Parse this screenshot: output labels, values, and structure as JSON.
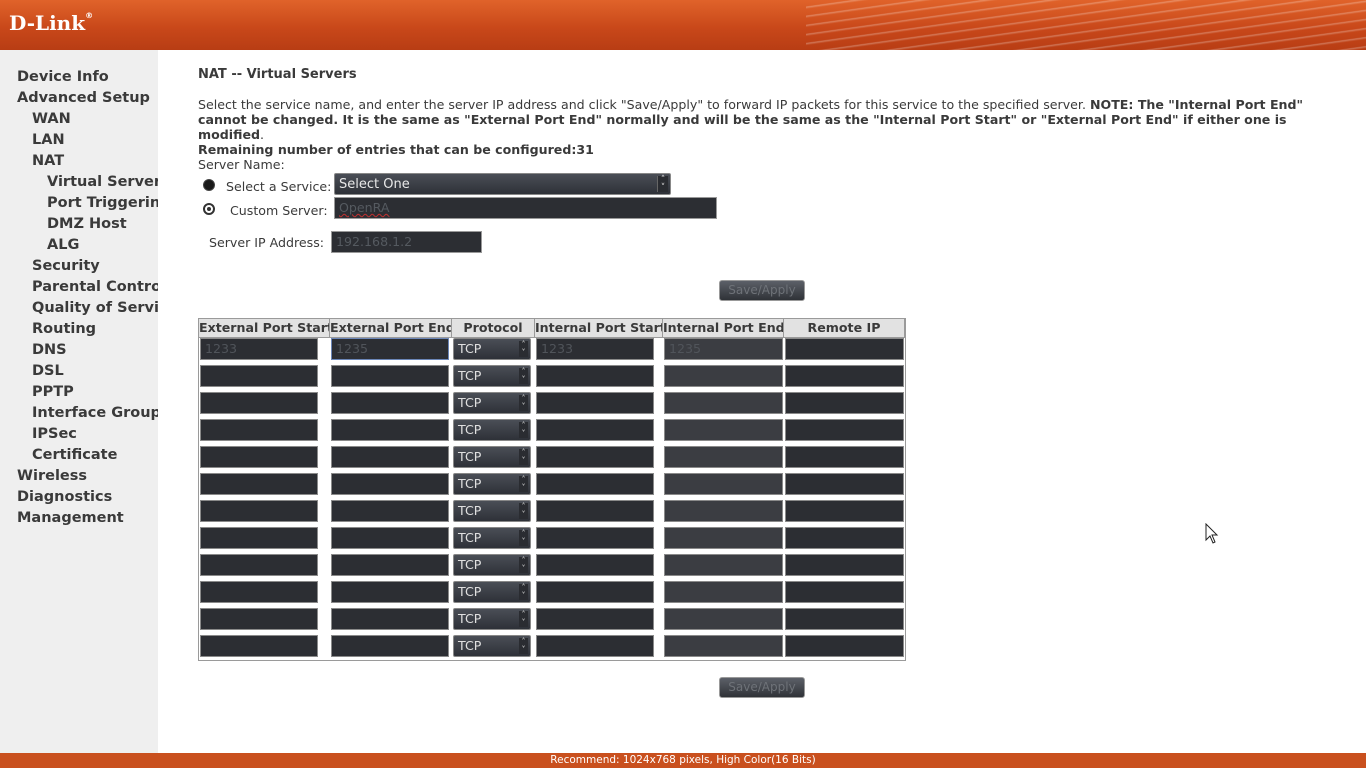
{
  "header": {
    "logo": "D-Link",
    "logo_mark": "®"
  },
  "sidebar": {
    "items": [
      {
        "label": "Device Info",
        "level": 0
      },
      {
        "label": "Advanced Setup",
        "level": 0
      },
      {
        "label": "WAN",
        "level": 1
      },
      {
        "label": "LAN",
        "level": 1
      },
      {
        "label": "NAT",
        "level": 1
      },
      {
        "label": "Virtual Servers",
        "level": 2
      },
      {
        "label": "Port Triggering",
        "level": 2
      },
      {
        "label": "DMZ Host",
        "level": 2
      },
      {
        "label": "ALG",
        "level": 2
      },
      {
        "label": "Security",
        "level": 1
      },
      {
        "label": "Parental Control",
        "level": 1
      },
      {
        "label": "Quality of Service",
        "level": 1
      },
      {
        "label": "Routing",
        "level": 1
      },
      {
        "label": "DNS",
        "level": 1
      },
      {
        "label": "DSL",
        "level": 1
      },
      {
        "label": "PPTP",
        "level": 1
      },
      {
        "label": "Interface Grouping",
        "level": 1
      },
      {
        "label": "IPSec",
        "level": 1
      },
      {
        "label": "Certificate",
        "level": 1
      },
      {
        "label": "Wireless",
        "level": 0
      },
      {
        "label": "Diagnostics",
        "level": 0
      },
      {
        "label": "Management",
        "level": 0
      }
    ]
  },
  "main": {
    "title": "NAT -- Virtual Servers",
    "desc_text": "Select the service name, and enter the server IP address and click \"Save/Apply\" to forward IP packets for this service to the specified server.",
    "desc_note": "NOTE: The \"Internal Port End\" cannot be changed. It is the same as \"External Port End\" normally and will be the same as the \"Internal Port Start\" or \"External Port End\" if either one is modified",
    "desc_period": ".",
    "remaining": "Remaining number of entries that can be configured:31",
    "server_name_label": "Server Name:",
    "select_service_label": "Select a Service:",
    "select_service_value": "Select One",
    "custom_server_label": "Custom Server:",
    "custom_server_value": "OpenRA",
    "server_ip_label": "Server IP Address:",
    "server_ip_value": "192.168.1.2",
    "save_apply": "Save/Apply"
  },
  "table": {
    "headers": [
      "External Port Start",
      "External Port End",
      "Protocol",
      "Internal Port Start",
      "Internal Port End",
      "Remote IP"
    ],
    "rows": [
      {
        "ext_start": "1233",
        "ext_end": "1235",
        "protocol": "TCP",
        "int_start": "1233",
        "int_end": "1235",
        "remote_ip": ""
      },
      {
        "ext_start": "",
        "ext_end": "",
        "protocol": "TCP",
        "int_start": "",
        "int_end": "",
        "remote_ip": ""
      },
      {
        "ext_start": "",
        "ext_end": "",
        "protocol": "TCP",
        "int_start": "",
        "int_end": "",
        "remote_ip": ""
      },
      {
        "ext_start": "",
        "ext_end": "",
        "protocol": "TCP",
        "int_start": "",
        "int_end": "",
        "remote_ip": ""
      },
      {
        "ext_start": "",
        "ext_end": "",
        "protocol": "TCP",
        "int_start": "",
        "int_end": "",
        "remote_ip": ""
      },
      {
        "ext_start": "",
        "ext_end": "",
        "protocol": "TCP",
        "int_start": "",
        "int_end": "",
        "remote_ip": ""
      },
      {
        "ext_start": "",
        "ext_end": "",
        "protocol": "TCP",
        "int_start": "",
        "int_end": "",
        "remote_ip": ""
      },
      {
        "ext_start": "",
        "ext_end": "",
        "protocol": "TCP",
        "int_start": "",
        "int_end": "",
        "remote_ip": ""
      },
      {
        "ext_start": "",
        "ext_end": "",
        "protocol": "TCP",
        "int_start": "",
        "int_end": "",
        "remote_ip": ""
      },
      {
        "ext_start": "",
        "ext_end": "",
        "protocol": "TCP",
        "int_start": "",
        "int_end": "",
        "remote_ip": ""
      },
      {
        "ext_start": "",
        "ext_end": "",
        "protocol": "TCP",
        "int_start": "",
        "int_end": "",
        "remote_ip": ""
      },
      {
        "ext_start": "",
        "ext_end": "",
        "protocol": "TCP",
        "int_start": "",
        "int_end": "",
        "remote_ip": ""
      }
    ]
  },
  "footer": {
    "text": "Recommend: 1024x768 pixels, High Color(16 Bits)"
  },
  "colors": {
    "brand_orange": "#c9481a",
    "sidebar_bg": "#efefef",
    "input_dark": "#2c2e33"
  },
  "icons": {
    "cursor": "mouse-pointer-icon",
    "select_arrows": "updown-arrows-icon"
  }
}
